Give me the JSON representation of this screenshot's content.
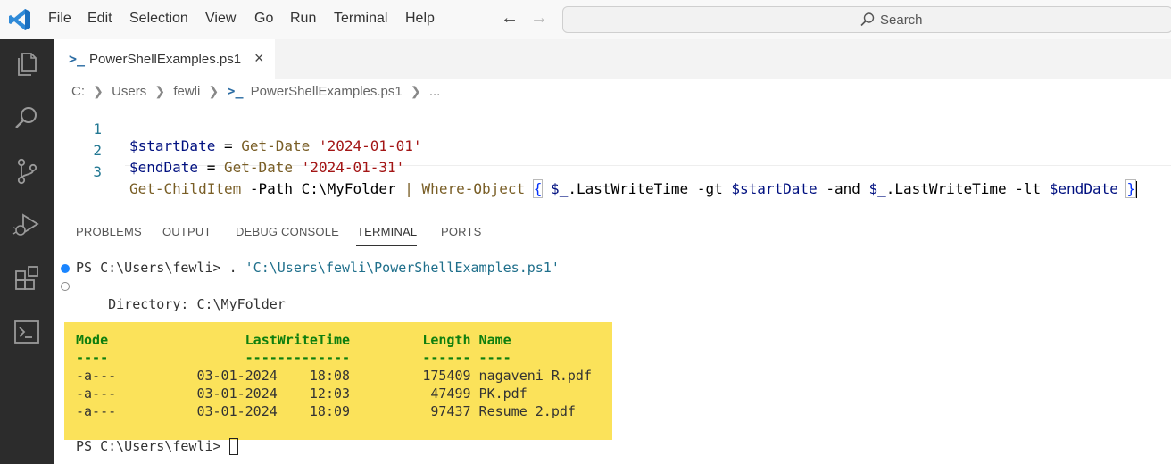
{
  "menu": [
    "File",
    "Edit",
    "Selection",
    "View",
    "Go",
    "Run",
    "Terminal",
    "Help"
  ],
  "search": {
    "label": "Search"
  },
  "icons": {
    "app": "vscode-logo-icon",
    "nav_back": "arrow-left-icon",
    "nav_forward": "arrow-right-icon",
    "activity": [
      "explorer-icon",
      "search-icon",
      "source-control-icon",
      "run-debug-icon",
      "extensions-icon",
      "terminal-icon"
    ]
  },
  "tab": {
    "icon": ">_",
    "label": "PowerShellExamples.ps1",
    "close": "×"
  },
  "breadcrumb": {
    "drive": "C:",
    "users": "Users",
    "user": "fewli",
    "file": "PowerShellExamples.ps1",
    "more": "..."
  },
  "editor": {
    "lines": [
      {
        "num": "1",
        "var": "$startDate",
        "eq": " = ",
        "cmd": "Get-Date",
        "sp": " ",
        "str": "'2024-01-01'"
      },
      {
        "num": "2",
        "var": "$endDate",
        "eq": " = ",
        "cmd": "Get-Date",
        "sp": " ",
        "str": "'2024-01-31'"
      }
    ],
    "line3": {
      "num": "3",
      "cmd1": "Get-ChildItem",
      "param": " -Path C:\\MyFolder ",
      "pipe": "|",
      "sp": " ",
      "cmd2": "Where-Object",
      "open": "{",
      "v1": " $_",
      "p1": ".LastWriteTime -gt ",
      "v2": "$startDate",
      "p2": " -and ",
      "v3": "$_",
      "p3": ".LastWriteTime -lt ",
      "v4": "$endDate",
      "close": "}"
    }
  },
  "panel": {
    "tabs": [
      "PROBLEMS",
      "OUTPUT",
      "DEBUG CONSOLE",
      "TERMINAL",
      "PORTS"
    ],
    "active_tab": "TERMINAL"
  },
  "terminal": {
    "prompt1": "PS C:\\Users\\fewli> . ",
    "script_path": "'C:\\Users\\fewli\\PowerShellExamples.ps1'",
    "directory": "    Directory: C:\\MyFolder",
    "header": "Mode                 LastWriteTime         Length Name",
    "underline": "----                 -------------         ------ ----",
    "rows": [
      "-a---          03-01-2024    18:08         175409 nagaveni R.pdf",
      "-a---          03-01-2024    12:03          47499 PK.pdf",
      "-a---          03-01-2024    18:09          97437 Resume 2.pdf"
    ],
    "prompt2": "PS C:\\Users\\fewli> "
  },
  "colors": {
    "activitybar": "#2c2c2c",
    "highlight": "#fbe25a",
    "accent": "#1a85ff"
  }
}
